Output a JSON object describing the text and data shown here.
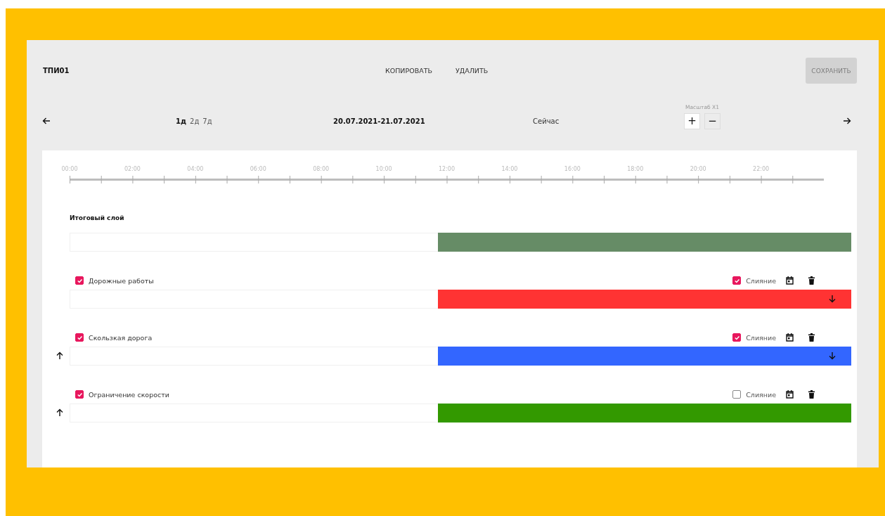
{
  "header": {
    "title": "ТПИ01",
    "actions": [
      "КОПИРОВАТЬ",
      "УДАЛИТЬ"
    ],
    "save_button": {
      "label": "СОХРАНИТЬ",
      "disabled": true
    }
  },
  "nav": {
    "periods": [
      {
        "label": "1д",
        "selected": true
      },
      {
        "label": "2д",
        "selected": false
      },
      {
        "label": "7д",
        "selected": false
      }
    ],
    "date_range": "20.07.2021-21.07.2021",
    "now_button": "Сейчас",
    "scale": {
      "label": "Масштаб X1",
      "zoom_in": "+",
      "zoom_out": "−"
    }
  },
  "timeline": {
    "labels": [
      "00:00",
      "02:00",
      "04:00",
      "06:00",
      "08:00",
      "10:00",
      "12:00",
      "14:00",
      "16:00",
      "18:00",
      "20:00",
      "22:00"
    ]
  },
  "result_layer": {
    "title": "Итоговый слой",
    "color": "#668c66",
    "level": 0.53
  },
  "layers": [
    {
      "name": "Дорожные работы",
      "visible": true,
      "merge_label": "Слияние",
      "merge": true,
      "color": "#ff3333",
      "level": 0.53,
      "can_move_up": false,
      "can_move_down": true
    },
    {
      "name": "Скользкая дорога",
      "visible": true,
      "merge_label": "Слияние",
      "merge": true,
      "color": "#3366ff",
      "level": 0.53,
      "can_move_up": true,
      "can_move_down": true
    },
    {
      "name": "Ограничение скорости",
      "visible": true,
      "merge_label": "Слияние",
      "merge": false,
      "color": "#339900",
      "level": 0.53,
      "can_move_up": true,
      "can_move_down": false
    }
  ]
}
